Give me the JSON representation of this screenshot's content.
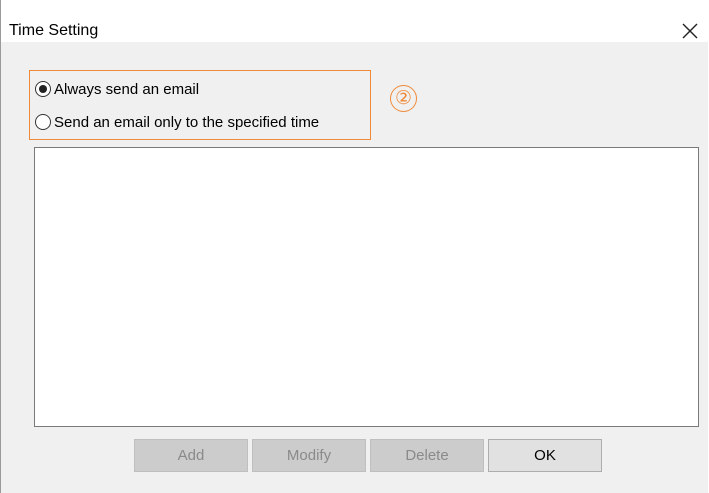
{
  "dialog": {
    "title": "Time Setting",
    "close_symbol": "×"
  },
  "send_mode": {
    "options": [
      {
        "label": "Always send an email",
        "selected": true
      },
      {
        "label": "Send an email only to the specified time",
        "selected": false
      }
    ],
    "step_marker": "②",
    "highlight_color": "#ef8a3a"
  },
  "time_list": {
    "items": []
  },
  "buttons": {
    "add_label": "Add",
    "modify_label": "Modify",
    "delete_label": "Delete",
    "ok_label": "OK"
  },
  "icons": {
    "close": "close-icon",
    "radio_selected": "radio-selected",
    "radio_unselected": "radio-unselected"
  }
}
